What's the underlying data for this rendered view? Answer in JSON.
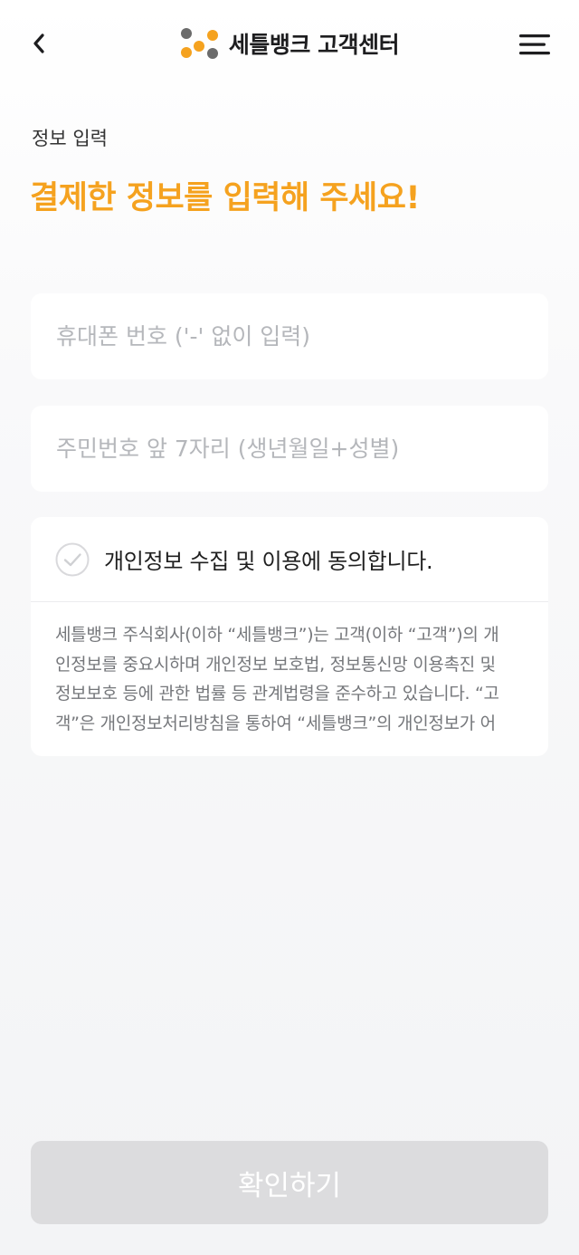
{
  "header": {
    "title": "세틀뱅크 고객센터",
    "back_icon": "chevron-left-icon",
    "menu_icon": "hamburger-menu-icon",
    "logo_colors": {
      "orange": "#f5a21f",
      "gray": "#6b6b6b"
    }
  },
  "page": {
    "step_label": "정보 입력",
    "headline": "결제한 정보를 입력해 주세요!",
    "accent_color": "#f5a21f"
  },
  "form": {
    "phone_placeholder": "휴대폰 번호 ('-' 없이 입력)",
    "phone_value": "",
    "rrn_placeholder": "주민번호 앞 7자리 (생년월일+성별)",
    "rrn_value": ""
  },
  "consent": {
    "label": "개인정보 수집 및 이용에 동의합니다.",
    "checked": false,
    "text_lines": [
      "세틀뱅크 주식회사(이하 “세틀뱅크”)는 고객(이하 “고객”)의 개",
      "인정보를 중요시하며 개인정보 보호법, 정보통신망 이용촉진 및",
      "정보보호 등에 관한 법률 등 관계법령을 준수하고 있습니다. “고",
      "객”은 개인정보처리방침을 통하여 “세틀뱅크”의 개인정보가 어"
    ]
  },
  "confirm": {
    "label": "확인하기",
    "enabled": false
  }
}
